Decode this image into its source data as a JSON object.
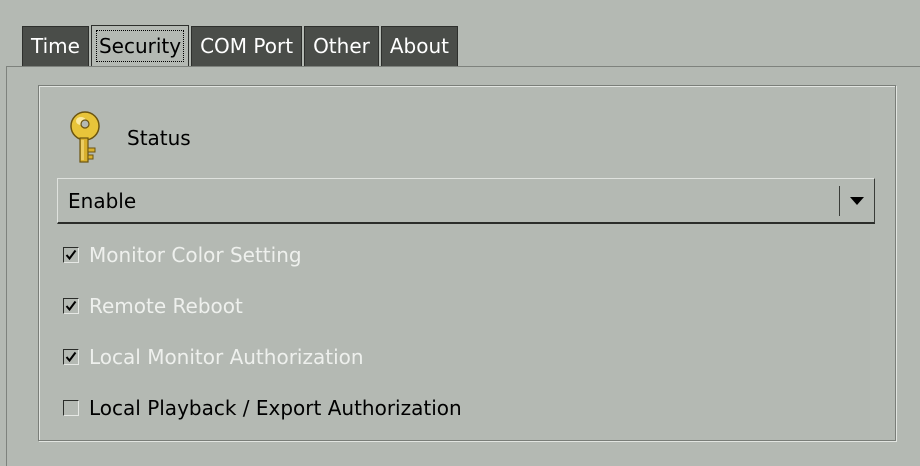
{
  "tabs": [
    {
      "label": "Time",
      "active": false
    },
    {
      "label": "Security",
      "active": true
    },
    {
      "label": "COM Port",
      "active": false
    },
    {
      "label": "Other",
      "active": false
    },
    {
      "label": "About",
      "active": false
    }
  ],
  "security": {
    "status_icon": "key-icon",
    "status_label": "Status",
    "dropdown": {
      "selected": "Enable",
      "arrow_icon": "chevron-down-icon"
    },
    "options": [
      {
        "label": "Monitor Color Setting",
        "checked": true,
        "enabled": false
      },
      {
        "label": "Remote Reboot",
        "checked": true,
        "enabled": false
      },
      {
        "label": "Local Monitor Authorization",
        "checked": true,
        "enabled": false
      },
      {
        "label": "Local Playback / Export Authorization",
        "checked": false,
        "enabled": true
      }
    ]
  },
  "colors": {
    "background": "#b4b9b3",
    "tab_inactive": "#4a4d49",
    "disabled_text": "#eef0ed",
    "key_gold": "#e8c43a"
  }
}
